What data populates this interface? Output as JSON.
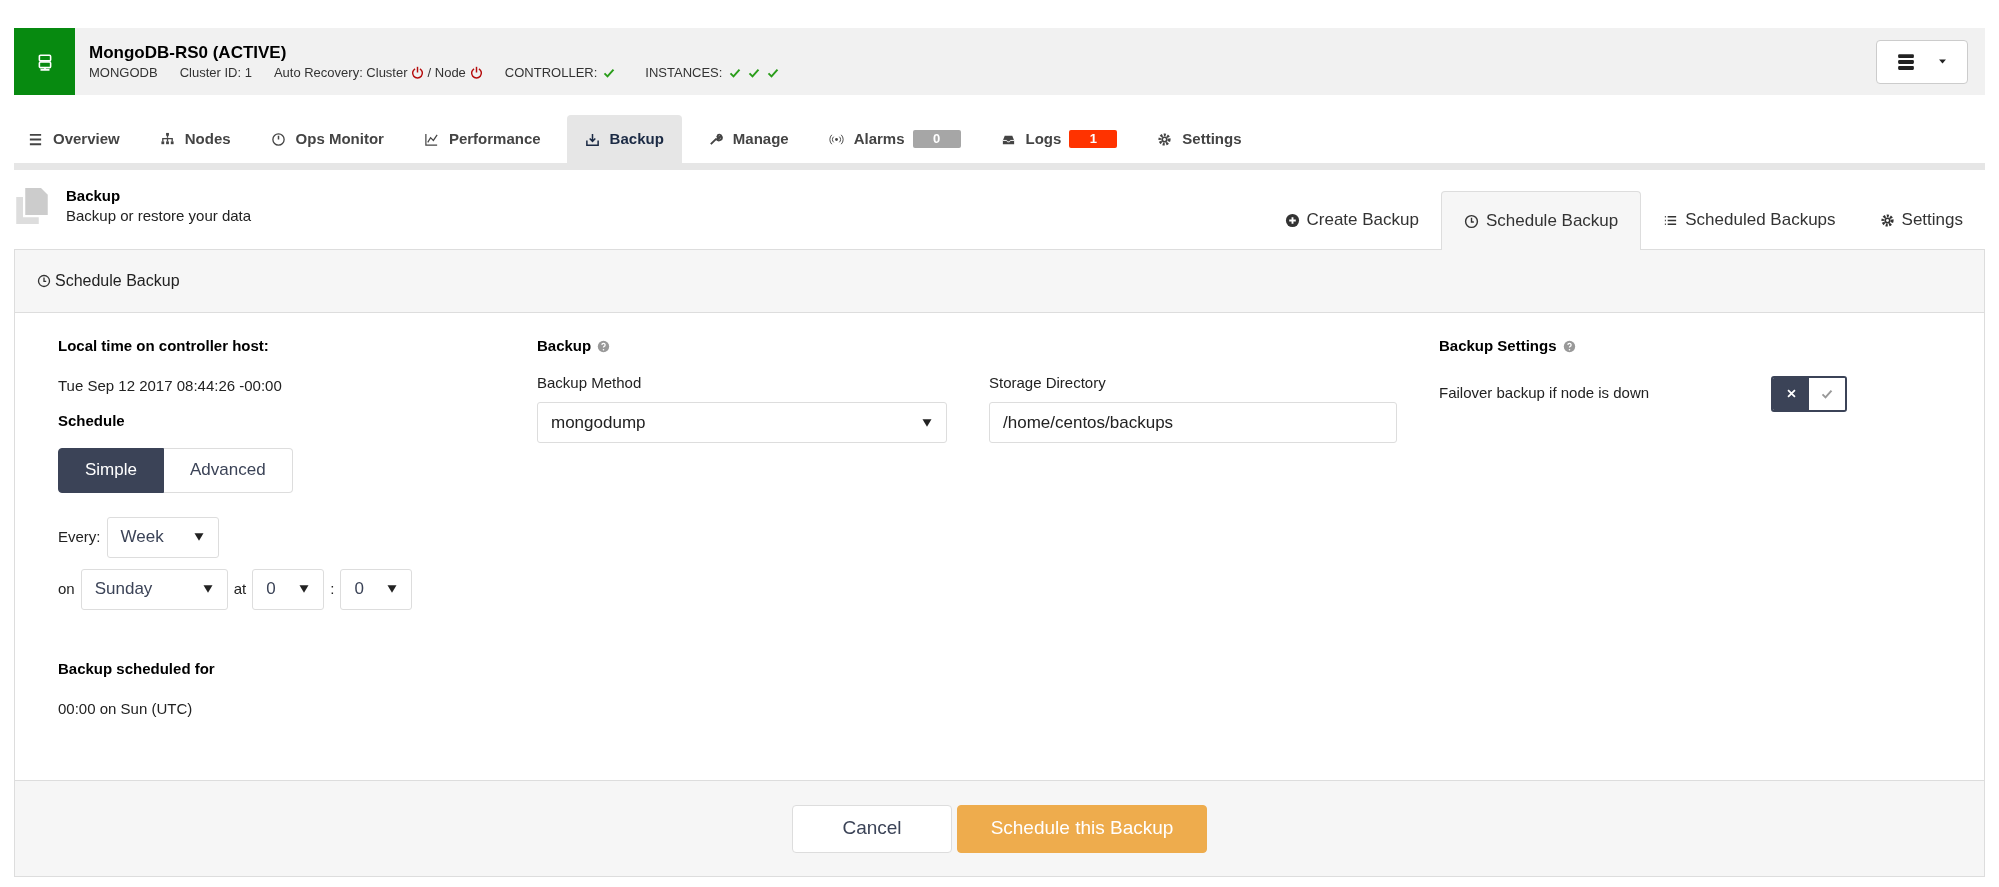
{
  "cluster": {
    "title": "MongoDB-RS0 (ACTIVE)",
    "type": "MONGODB",
    "cluster_id": "Cluster ID: 1",
    "auto_recovery_label": "Auto Recovery: Cluster",
    "node_label": "/ Node",
    "cluster_recovery_on": false,
    "node_recovery_on": false,
    "controller_label": "CONTROLLER:",
    "controller_ok": true,
    "instances_label": "INSTANCES:",
    "instances": [
      {
        "ok": true
      },
      {
        "ok": true
      },
      {
        "ok": true
      }
    ]
  },
  "tabs": [
    {
      "label": "Overview",
      "kind": "menu",
      "selected": false
    },
    {
      "label": "Nodes",
      "kind": "sitemap",
      "selected": false
    },
    {
      "label": "Ops Monitor",
      "kind": "gauge",
      "selected": false
    },
    {
      "label": "Performance",
      "kind": "chart",
      "selected": false
    },
    {
      "label": "Backup",
      "kind": "download",
      "selected": true
    },
    {
      "label": "Manage",
      "kind": "wrench",
      "selected": false
    },
    {
      "label": "Alarms",
      "kind": "signal",
      "selected": false,
      "badge": "0",
      "color": "#a6a6a6"
    },
    {
      "label": "Logs",
      "kind": "inbox",
      "selected": false,
      "badge": "1",
      "color": "#ff3300"
    },
    {
      "label": "Settings",
      "kind": "gear",
      "selected": false
    }
  ],
  "page": {
    "title": "Backup",
    "subtitle": "Backup or restore your data"
  },
  "subtabs": [
    {
      "label": "Create Backup",
      "kind": "plus",
      "selected": false
    },
    {
      "label": "Schedule Backup",
      "kind": "clock",
      "selected": true
    },
    {
      "label": "Scheduled Backups",
      "kind": "list",
      "selected": false
    },
    {
      "label": "Settings",
      "kind": "gear",
      "selected": false
    }
  ],
  "panel": {
    "title": "Schedule Backup",
    "local_time_label": "Local time on controller host:",
    "local_time": "Tue Sep 12 2017 08:44:26 -00:00",
    "schedule_label": "Schedule",
    "schedule_modes": [
      {
        "label": "Simple",
        "selected": true
      },
      {
        "label": "Advanced",
        "selected": false
      }
    ],
    "every_label": "Every:",
    "every": "Week",
    "on_label": "on",
    "day": "Sunday",
    "at_label": "at",
    "hour": "0",
    "colon": ":",
    "minute": "0",
    "scheduled_for_label": "Backup scheduled for",
    "scheduled_for": "00:00 on Sun (UTC)",
    "backup_heading": "Backup",
    "method_label": "Backup Method",
    "method": "mongodump",
    "storage_label": "Storage Directory",
    "storage": "/home/centos/backups",
    "settings_heading": "Backup Settings",
    "failover_label": "Failover backup if node is down",
    "failover_on": false
  },
  "buttons": [
    {
      "label": "Cancel",
      "kind": "default"
    },
    {
      "label": "Schedule this Backup",
      "kind": "primary"
    }
  ]
}
